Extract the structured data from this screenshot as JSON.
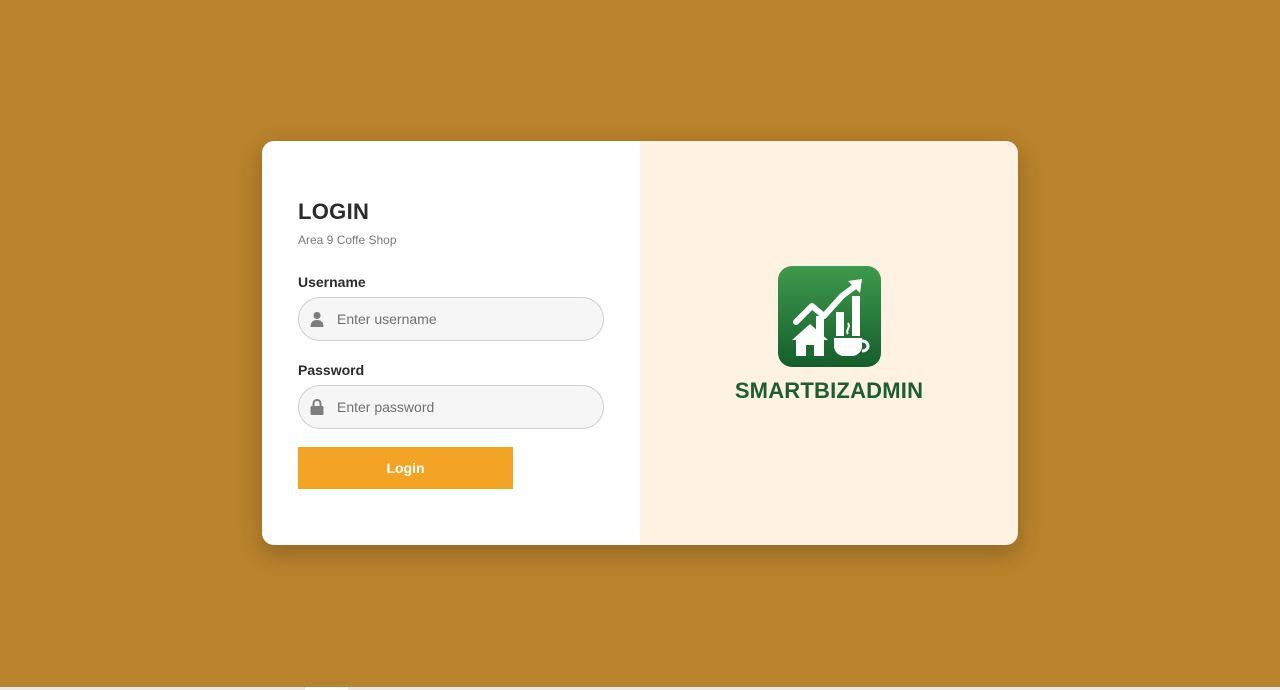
{
  "login": {
    "title": "LOGIN",
    "subtitle": "Area 9 Coffe Shop",
    "username_label": "Username",
    "username_placeholder": "Enter username",
    "username_value": "",
    "password_label": "Password",
    "password_placeholder": "Enter password",
    "password_value": "",
    "button_label": "Login"
  },
  "brand": {
    "name": "SMARTBIZADMIN",
    "logo_icon": "chart-house-coffee-icon"
  },
  "icons": {
    "username": "user-icon",
    "password": "lock-icon"
  },
  "colors": {
    "background": "#B9822C",
    "panel_left": "#FFFFFF",
    "panel_right": "#FEF3E2",
    "button": "#F4A425",
    "brand_text": "#1E5E2E",
    "logo_green": "#1F7A3A"
  }
}
